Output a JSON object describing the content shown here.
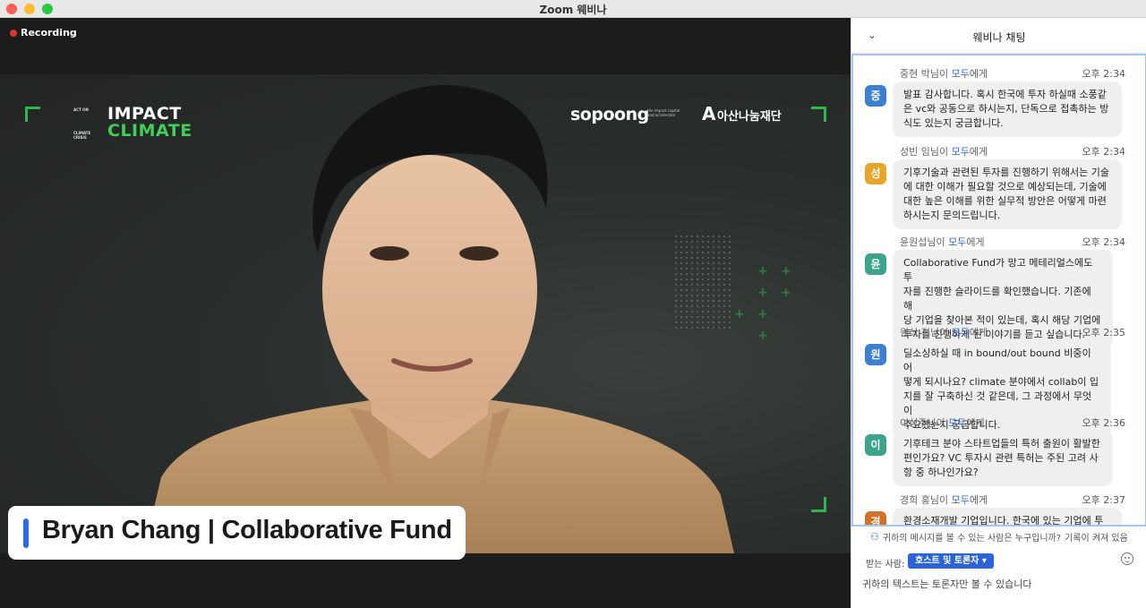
{
  "window": {
    "title": "Zoom 웨비나"
  },
  "recording": {
    "label": "Recording"
  },
  "video": {
    "logo_impact": "IMPACT",
    "logo_climate": "CLIMATE",
    "logo_small_top": "ACT ON",
    "logo_small_bottom": "CLIMATE CRISIS",
    "sopoong": "sopoong",
    "sopoong_sub": "the impact capital and accelerator",
    "asan_mark": "A",
    "asan": "아산나눔재단",
    "speaker_name": "Bryan Chang | Collaborative Fund"
  },
  "chat": {
    "title": "웨비나 채팅",
    "messages": [
      {
        "sender": "중현 박님이",
        "to": "모두",
        "to_suffix": "에게",
        "time": "오후 2:34",
        "initial": "중",
        "color": "#3d7fd1",
        "lines": [
          "발표 감사합니다. 혹시 한국에 투자 하실때 소풍같",
          "은 vc와 공동으로 하시는지, 단독으로 접촉하는 방",
          "식도 있는지 궁금합니다."
        ]
      },
      {
        "sender": "성빈 임님이",
        "to": "모두",
        "to_suffix": "에게",
        "time": "오후 2:34",
        "initial": "성",
        "color": "#e8a52c",
        "lines": [
          "기후기술과 관련된 투자를 진행하기 위해서는 기술",
          "에 대한 이해가 필요할 것으로 예상되는데, 기술에",
          "대한 높은 이해를 위한 실무적 방안은 어떻게 마련",
          "하시는지 문의드립니다."
        ]
      },
      {
        "sender": "윤원섭님이",
        "to": "모두",
        "to_suffix": "에게",
        "time": "오후 2:34",
        "initial": "윤",
        "color": "#3aa58a",
        "lines": [
          "Collaborative Fund가 망고 메테리얼스에도 투",
          "자를 진행한 슬라이드를 확인했습니다. 기존에 해",
          "당 기업을 찾아본 적이 있는데, 혹시 해당 기업에",
          "투자를 진행하게 된 이야기를 듣고 싶습니다."
        ]
      },
      {
        "sender": "원식 정님이",
        "to": "모두",
        "to_suffix": "에게",
        "time": "오후 2:35",
        "initial": "원",
        "color": "#3d7fd1",
        "lines": [
          "딜소싱하실 때 in bound/out bound 비중이 어",
          "떻게 되시나요? climate 분야에서 collab이 입",
          "지를 잘 구축하신 것 같은데, 그 과정에서 무엇이",
          "주요했는지 궁금합니다."
        ]
      },
      {
        "sender": "이성주님이",
        "to": "모두",
        "to_suffix": "에게",
        "time": "오후 2:36",
        "initial": "이",
        "color": "#3aa58a",
        "lines": [
          "기후테크 분야 스타트업들의 특허 출원이 활발한",
          "편인가요? VC 투자시 관련 특허는 주된 고려 사",
          "항 중 하나인가요?"
        ]
      },
      {
        "sender": "경희 홍님이",
        "to": "모두",
        "to_suffix": "에게",
        "time": "오후 2:37",
        "initial": "경",
        "color": "#d0722a",
        "lines": [
          "환경소재개발 기업입니다. 한국에 있는 기업에 투"
        ]
      }
    ],
    "notice": "귀하의 메시지를 볼 수 있는 사람은 누구입니까?",
    "notice_recording": "기록이 켜져 있음",
    "to_label": "받는 사람:",
    "to_value": "호스트 및 토론자",
    "input_placeholder": "귀하의 텍스트는 토론자만 볼 수 있습니다"
  }
}
